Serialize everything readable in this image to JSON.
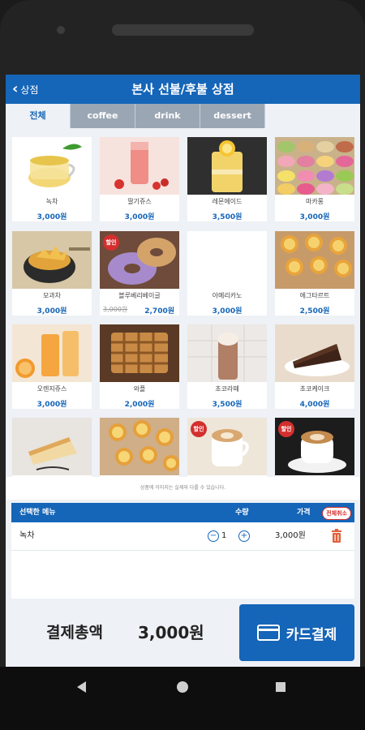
{
  "app": {
    "back_label": "상점",
    "title": "본사 선불/후불 상점"
  },
  "tabs": [
    {
      "label": "전체",
      "active": true
    },
    {
      "label": "coffee",
      "active": false
    },
    {
      "label": "drink",
      "active": false
    },
    {
      "label": "dessert",
      "active": false
    }
  ],
  "sale_badge": "할인",
  "menu": [
    {
      "name": "녹차",
      "price": "3,000원",
      "icon": "green-tea-image"
    },
    {
      "name": "딸기쥬스",
      "price": "3,000원",
      "icon": "strawberry-juice-image"
    },
    {
      "name": "레몬에이드",
      "price": "3,500원",
      "icon": "lemonade-image"
    },
    {
      "name": "마카롱",
      "price": "3,000원",
      "icon": "macaron-image"
    },
    {
      "name": "모과차",
      "price": "3,000원",
      "icon": "quince-tea-image"
    },
    {
      "name": "블루베리베이글",
      "original_price": "3,000원",
      "price": "2,700원",
      "sale": true,
      "icon": "blueberry-bagel-image"
    },
    {
      "name": "아메리카노",
      "price": "3,000원",
      "icon": "americano-image"
    },
    {
      "name": "에그타르트",
      "price": "2,500원",
      "icon": "egg-tart-image"
    },
    {
      "name": "오렌지쥬스",
      "price": "3,000원",
      "icon": "orange-juice-image"
    },
    {
      "name": "와플",
      "price": "2,000원",
      "icon": "waffle-image"
    },
    {
      "name": "초코라떼",
      "price": "3,500원",
      "icon": "choco-latte-image"
    },
    {
      "name": "초코케이크",
      "price": "4,000원",
      "icon": "choco-cake-image"
    },
    {
      "name": "",
      "price": "",
      "icon": "cheesecake-image"
    },
    {
      "name": "",
      "price": "",
      "icon": "egg-tart-image"
    },
    {
      "name": "",
      "price": "",
      "sale": true,
      "icon": "latte-image"
    },
    {
      "name": "",
      "price": "",
      "sale": true,
      "icon": "cappuccino-image"
    }
  ],
  "notice": "상품에 이미지는 실제와 다를 수 있습니다.",
  "order": {
    "header_menu": "선택한 메뉴",
    "header_qty": "수량",
    "header_price": "가격",
    "cancel_all": "전체취소",
    "items": [
      {
        "name": "녹차",
        "qty": "1",
        "price": "3,000원"
      }
    ]
  },
  "footer": {
    "total_label": "결제총액",
    "total_value": "3,000원",
    "pay_label": "카드결제"
  },
  "colors": {
    "primary": "#1565b8",
    "sale": "#d32f2f",
    "tab_inactive": "#9aa6b3"
  }
}
